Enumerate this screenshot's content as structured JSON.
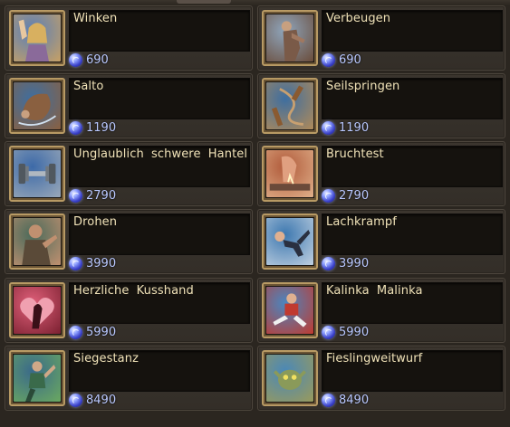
{
  "colors": {
    "background": "#2b2620",
    "card": "#3b352e",
    "name_text": "#f0e2b8",
    "price_text": "#b9c8ff",
    "icon_border": "#b89a64",
    "gem": "#3a40c8"
  },
  "currency_icon": "blue-gem-icon",
  "emotes": [
    {
      "name": "Winken",
      "price": "690",
      "icon": "waving-woman-icon",
      "art": [
        "#5a7fb8",
        "#c7a064"
      ]
    },
    {
      "name": "Verbeugen",
      "price": "690",
      "icon": "bowing-man-icon",
      "art": [
        "#8fa6bd",
        "#6a4c3a"
      ]
    },
    {
      "name": "Salto",
      "price": "1190",
      "icon": "somersault-icon",
      "art": [
        "#3e6ea0",
        "#8a6040"
      ]
    },
    {
      "name": "Seilspringen",
      "price": "1190",
      "icon": "jump-rope-icon",
      "art": [
        "#3e6ea0",
        "#b08a58"
      ]
    },
    {
      "name": "Unglaublich schwere Hantel",
      "price": "2790",
      "icon": "dumbbell-icon",
      "art": [
        "#3d6aa8",
        "#9aa8b8"
      ]
    },
    {
      "name": "Bruchtest",
      "price": "2790",
      "icon": "breaking-test-icon",
      "art": [
        "#b05a3a",
        "#e0b08a"
      ]
    },
    {
      "name": "Drohen",
      "price": "3990",
      "icon": "threatening-man-icon",
      "art": [
        "#4a6a5a",
        "#c09070"
      ]
    },
    {
      "name": "Lachkrampf",
      "price": "3990",
      "icon": "laughing-fall-icon",
      "art": [
        "#3d78b0",
        "#c0d0e0"
      ]
    },
    {
      "name": "Herzliche Kusshand",
      "price": "5990",
      "icon": "kiss-hand-heart-icon",
      "art": [
        "#e0607a",
        "#7a2030"
      ]
    },
    {
      "name": "Kalinka Malinka",
      "price": "5990",
      "icon": "cossack-dance-icon",
      "art": [
        "#4a86c0",
        "#c03a30"
      ]
    },
    {
      "name": "Siegestanz",
      "price": "8490",
      "icon": "victory-dance-icon",
      "art": [
        "#3a6a8a",
        "#6aa860"
      ]
    },
    {
      "name": "Fieslingweitwurf",
      "price": "8490",
      "icon": "goblin-throw-icon",
      "art": [
        "#4a88b8",
        "#9a9a5a"
      ]
    }
  ]
}
